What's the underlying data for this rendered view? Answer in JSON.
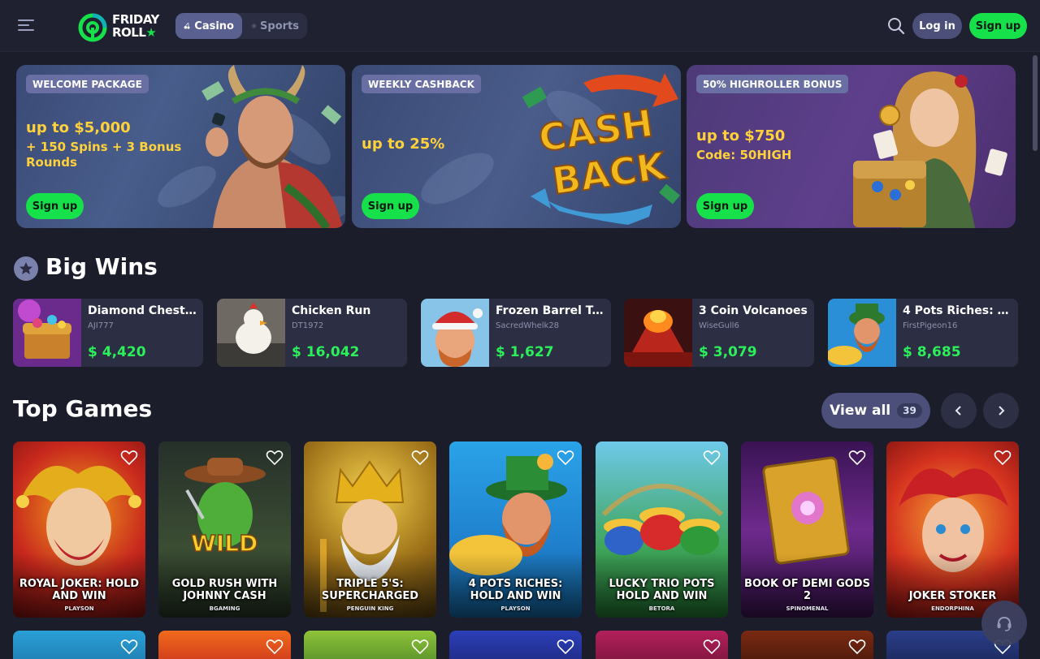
{
  "header": {
    "logo_line1": "FRIDAY",
    "logo_line2": "ROLL",
    "tabs": [
      {
        "label": "Casino",
        "icon": "cherries-icon",
        "active": true
      },
      {
        "label": "Sports",
        "icon": "soccer-ball-icon",
        "active": false
      }
    ],
    "login_label": "Log in",
    "signup_label": "Sign up"
  },
  "banners": [
    {
      "tag": "WELCOME PACKAGE",
      "title": "up to $5,000",
      "subtitle": "+ 150 Spins + 3 Bonus Rounds",
      "button": "Sign up"
    },
    {
      "tag": "WEEKLY CASHBACK",
      "title": "up to 25%",
      "subtitle": "",
      "button": "Sign up",
      "art_text_1": "CASH",
      "art_text_2": "BACK"
    },
    {
      "tag": "50% HIGHROLLER BONUS",
      "title": "up to $750",
      "subtitle": "Code: 50HIGH",
      "button": "Sign up"
    }
  ],
  "big_wins": {
    "title": "Big Wins",
    "items": [
      {
        "game": "Diamond Chest ...",
        "user": "AJI777",
        "amount": "$ 4,420"
      },
      {
        "game": "Chicken Run",
        "user": "DT1972",
        "amount": "$ 16,042"
      },
      {
        "game": "Frozen Barrel Ta...",
        "user": "SacredWhelk28",
        "amount": "$ 1,627"
      },
      {
        "game": "3 Coin Volcanoes",
        "user": "WiseGull6",
        "amount": "$ 3,079"
      },
      {
        "game": "4 Pots Riches: H...",
        "user": "FirstPigeon16",
        "amount": "$ 8,685"
      }
    ]
  },
  "top_games": {
    "title": "Top Games",
    "view_all_label": "View all",
    "view_all_count": "39",
    "games": [
      {
        "title": "ROYAL JOKER: HOLD AND WIN",
        "provider": "PLAYSON"
      },
      {
        "title": "GOLD RUSH WITH JOHNNY CASH",
        "provider": "BGAMING",
        "art_text": "WILD"
      },
      {
        "title": "TRIPLE 5'S: SUPERCHARGED",
        "provider": "PENGUIN KING"
      },
      {
        "title": "4 POTS RICHES: HOLD AND WIN",
        "provider": "PLAYSON"
      },
      {
        "title": "LUCKY TRIO POTS HOLD AND WIN",
        "provider": "BETORA"
      },
      {
        "title": "BOOK OF DEMI GODS 2",
        "provider": "SPINOMENAL"
      },
      {
        "title": "JOKER STOKER",
        "provider": "ENDORPHINA"
      }
    ]
  },
  "colors": {
    "background": "#1b1d2b",
    "accent_green": "#17e14a",
    "win_green": "#2bf05a",
    "promo_yellow": "#ffd13a",
    "button_purple": "#4b4f79"
  }
}
